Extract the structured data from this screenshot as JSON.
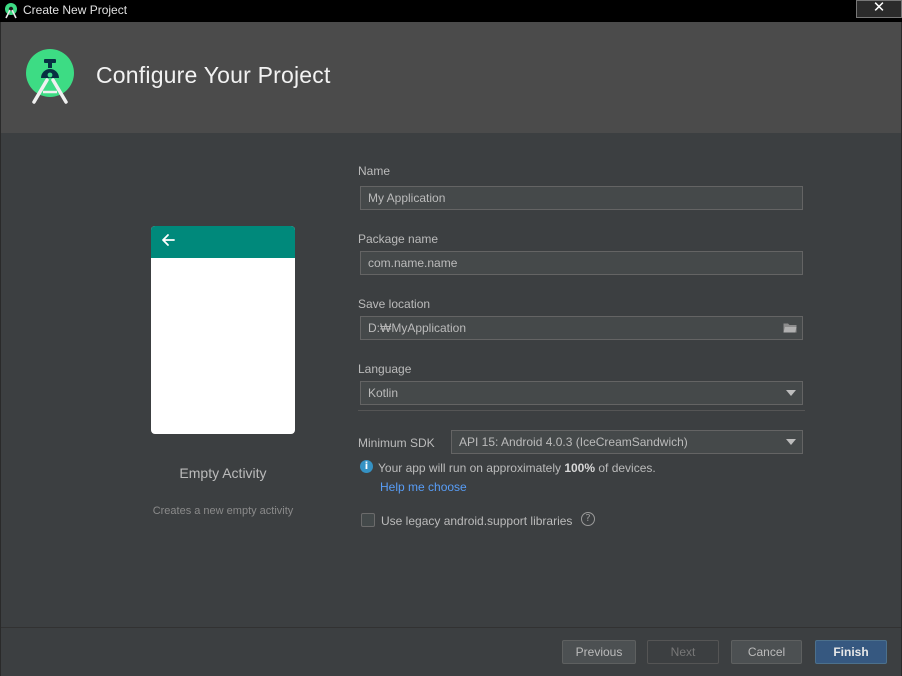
{
  "window": {
    "title": "Create New Project",
    "close_symbol": "✕",
    "app_icon": "android-studio-icon"
  },
  "header": {
    "title": "Configure Your Project",
    "logo": "android-studio-logo"
  },
  "preview": {
    "activity_name": "Empty Activity",
    "activity_description": "Creates a new empty activity",
    "appbar_color": "#00897b",
    "back_icon": "arrow-left-icon"
  },
  "form": {
    "name_label": "Name",
    "name_value": "My Application",
    "package_label": "Package name",
    "package_value": "com.name.name",
    "save_label": "Save location",
    "save_value": "D:₩MyApplication",
    "language_label": "Language",
    "language_value": "Kotlin",
    "min_sdk_label": "Minimum SDK",
    "min_sdk_value": "API 15: Android 4.0.3 (IceCreamSandwich)",
    "info_prefix": "Your app will run on approximately ",
    "info_percent": "100%",
    "info_suffix": " of devices.",
    "help_link": "Help me choose",
    "legacy_label": "Use legacy android.support libraries",
    "legacy_checked": false
  },
  "footer": {
    "previous": "Previous",
    "next": "Next",
    "cancel": "Cancel",
    "finish": "Finish"
  },
  "colors": {
    "background": "#3c3f41",
    "header": "#4b4b4b",
    "primary_button": "#365880",
    "link": "#589df6"
  }
}
